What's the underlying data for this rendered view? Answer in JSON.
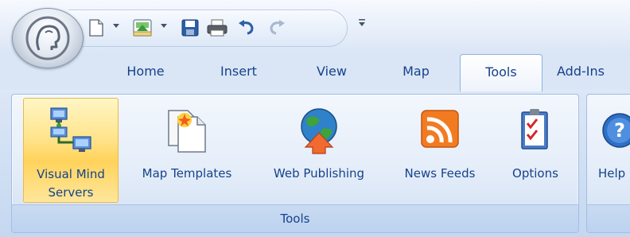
{
  "quick_access_toolbar": {
    "buttons": [
      {
        "name": "new-document-icon",
        "arrow": true
      },
      {
        "name": "open-folder-icon",
        "arrow": true
      },
      {
        "name": "save-icon",
        "arrow": false
      },
      {
        "name": "print-icon",
        "arrow": false
      },
      {
        "name": "undo-icon",
        "arrow": false
      },
      {
        "name": "redo-icon",
        "arrow": false
      }
    ],
    "customize_icon": "customize-qat-icon"
  },
  "tabs": [
    {
      "label": "Home"
    },
    {
      "label": "Insert"
    },
    {
      "label": "View"
    },
    {
      "label": "Map"
    },
    {
      "label": "Tools"
    },
    {
      "label": "Add-Ins"
    }
  ],
  "active_tab": "Tools",
  "ribbon": {
    "tools_group": {
      "label": "Tools",
      "buttons": [
        {
          "label_line1": "Visual Mind",
          "label_line2": "Servers",
          "icon": "network-servers-icon",
          "selected": true
        },
        {
          "label_line1": "Map Templates",
          "icon": "map-templates-icon",
          "selected": false
        },
        {
          "label_line1": "Web Publishing",
          "icon": "globe-publish-icon",
          "selected": false
        },
        {
          "label_line1": "News Feeds",
          "icon": "rss-feed-icon",
          "selected": false
        },
        {
          "label_line1": "Options",
          "icon": "options-checklist-icon",
          "selected": false
        }
      ]
    },
    "help_group": {
      "button_label": "Help",
      "icon": "help-icon"
    }
  },
  "colors": {
    "accent_text": "#15428b",
    "selected_button": "#ffd35b",
    "tab_bar": "#dae6f6"
  }
}
